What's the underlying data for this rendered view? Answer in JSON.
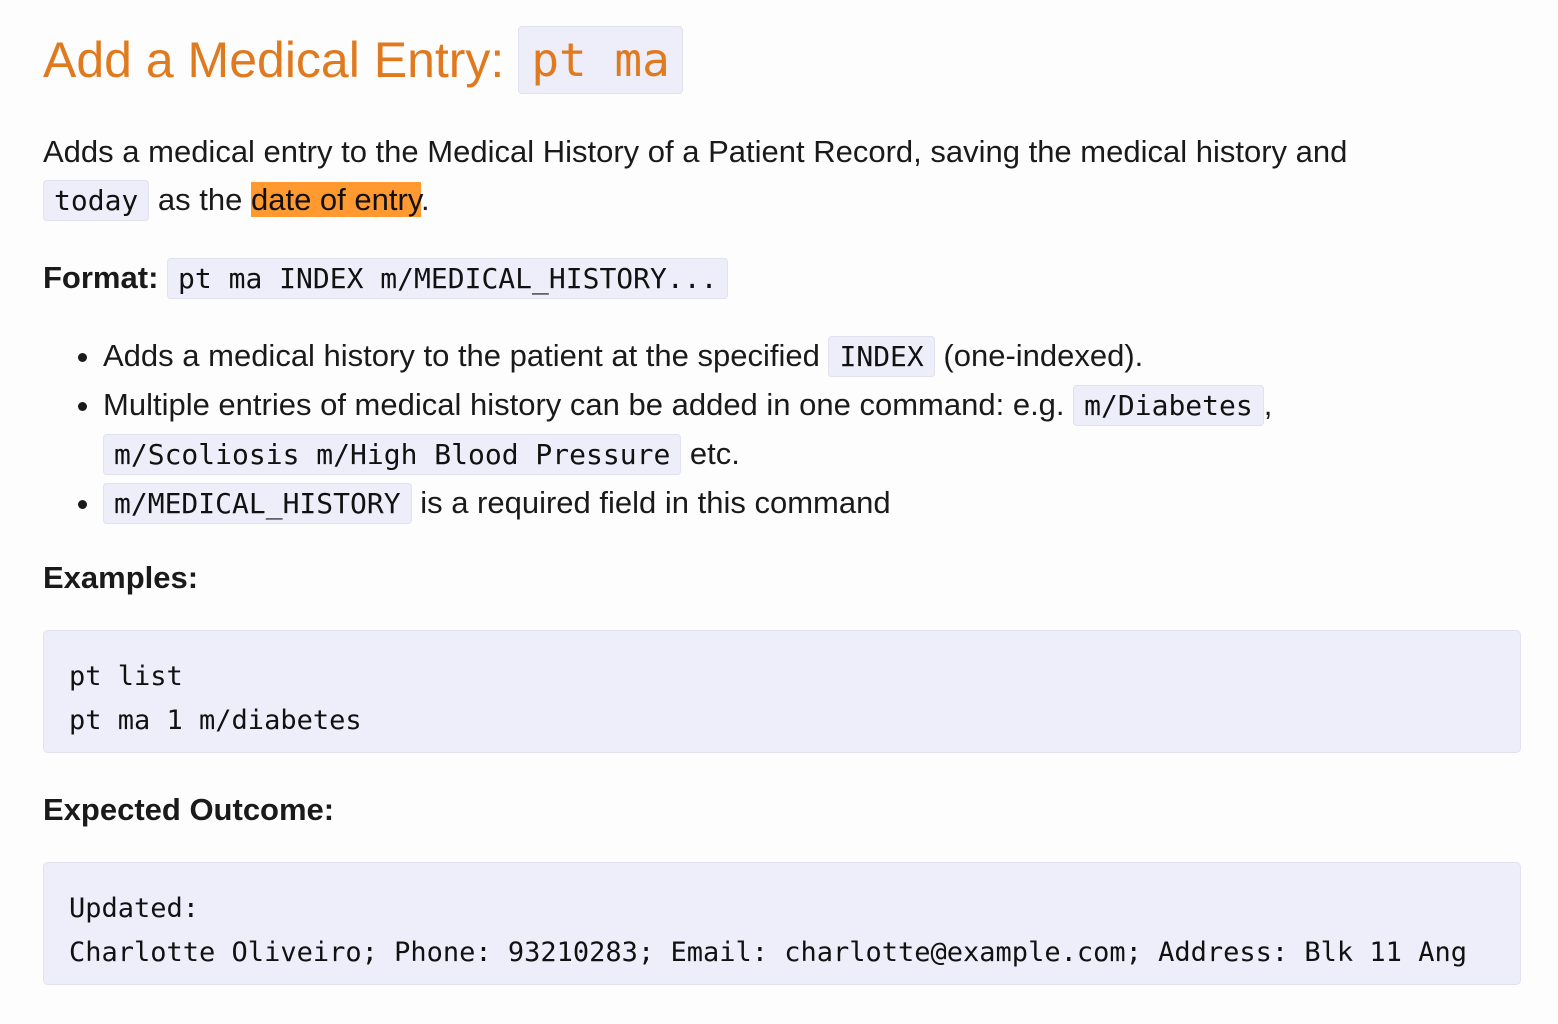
{
  "title": {
    "text": "Add a Medical Entry:",
    "command": "pt ma"
  },
  "intro": {
    "part1": "Adds a medical entry to the Medical History of a Patient Record, saving the medical history and",
    "code_today": "today",
    "part2": " as the ",
    "highlight": "date of entry",
    "part3": "."
  },
  "format": {
    "label": "Format:",
    "code": "pt ma INDEX m/MEDICAL_HISTORY..."
  },
  "bullets": {
    "b1_text": "Adds a medical history to the patient at the specified ",
    "b1_code": "INDEX",
    "b1_tail": " (one-indexed).",
    "b2_text": "Multiple entries of medical history can be added in one command: e.g. ",
    "b2_code1": "m/Diabetes",
    "b2_sep": ",",
    "b2_code2": "m/Scoliosis m/High Blood Pressure",
    "b2_tail": " etc.",
    "b3_code": "m/MEDICAL_HISTORY",
    "b3_tail": " is a required field in this command"
  },
  "examples": {
    "label": "Examples:",
    "code": "pt list\npt ma 1 m/diabetes"
  },
  "outcome": {
    "label": "Expected Outcome:",
    "code": "Updated:\nCharlotte Oliveiro; Phone: 93210283; Email: charlotte@example.com; Address: Blk 11 Ang"
  },
  "colors": {
    "heading": "#e07a1f",
    "highlight": "#ff9930",
    "code_bg": "#eeeefb"
  }
}
